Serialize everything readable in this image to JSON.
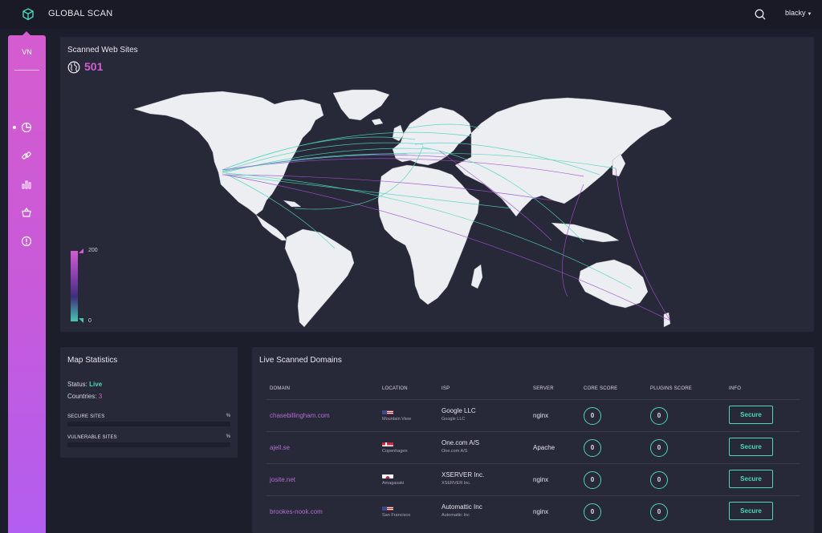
{
  "header": {
    "title": "GLOBAL SCAN",
    "user": "blacky"
  },
  "sidebar": {
    "initials": "VN",
    "items": [
      {
        "icon": "pie-chart-icon",
        "active": true
      },
      {
        "icon": "link-icon",
        "active": false
      },
      {
        "icon": "bar-chart-icon",
        "active": false
      },
      {
        "icon": "basket-icon",
        "active": false
      },
      {
        "icon": "alert-icon",
        "active": false
      }
    ]
  },
  "map_panel": {
    "title": "Scanned Web Sites",
    "count": "501",
    "legend_max": "200",
    "legend_min": "0"
  },
  "stats": {
    "title": "Map Statistics",
    "status_label": "Status:",
    "status_value": "Live",
    "countries_label": "Countries:",
    "countries_value": "3",
    "secure_label": "SECURE SITES",
    "secure_pct": "%",
    "vulnerable_label": "VULNERABLE SITES",
    "vulnerable_pct": "%"
  },
  "domains": {
    "title": "Live Scanned Domains",
    "columns": [
      "DOMAIN",
      "LOCATION",
      "ISP",
      "SERVER",
      "CORE SCORE",
      "PLUGINS SCORE",
      "INFO"
    ],
    "rows": [
      {
        "domain": "chasebillingham.com",
        "flag": "us",
        "location": "Mountain View",
        "isp": "Google LLC",
        "isp_sub": "Google LLC",
        "server": "nginx",
        "core": "0",
        "plugins": "0",
        "info": "Secure"
      },
      {
        "domain": "ajell.se",
        "flag": "dk",
        "location": "Copenhagen",
        "isp": "One.com A/S",
        "isp_sub": "One.com A/S",
        "server": "Apache",
        "core": "0",
        "plugins": "0",
        "info": "Secure"
      },
      {
        "domain": "josite.net",
        "flag": "jp",
        "location": "Amagasaki",
        "isp": "XSERVER Inc.",
        "isp_sub": "XSERVER Inc.",
        "server": "nginx",
        "core": "0",
        "plugins": "0",
        "info": "Secure"
      },
      {
        "domain": "brookes-nook.com",
        "flag": "us",
        "location": "San Francisco",
        "isp": "Automattic Inc",
        "isp_sub": "Automattic Inc",
        "server": "nginx",
        "core": "0",
        "plugins": "0",
        "info": "Secure"
      }
    ]
  },
  "colors": {
    "accent_pink": "#d35fd3",
    "accent_teal": "#4fd6bb",
    "background": "#1d1e2b",
    "panel": "#272838"
  }
}
